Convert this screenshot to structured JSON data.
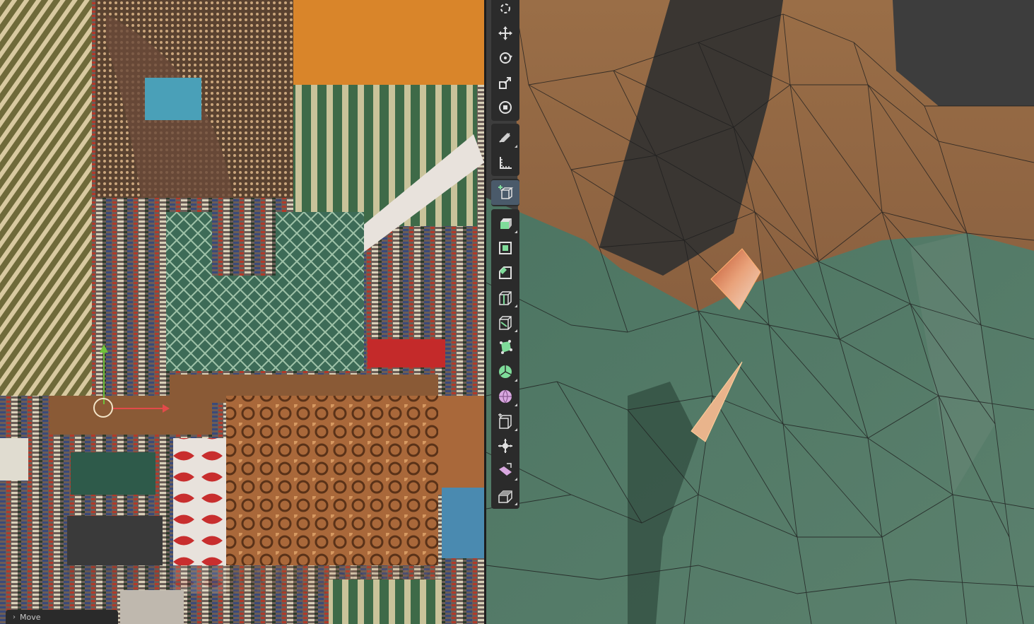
{
  "last_operator": {
    "label": "Move",
    "expand_icon": "chevron-right-icon"
  },
  "toolbar": {
    "groups": [
      [
        "cursor-tool",
        "move-tool",
        "rotate-tool",
        "scale-tool",
        "transform-tool"
      ],
      [
        "annotate-tool",
        "measure-tool"
      ],
      [
        "add-cube-tool"
      ],
      [
        "extrude-region-tool",
        "inset-faces-tool",
        "bevel-tool",
        "loop-cut-tool",
        "knife-tool",
        "poly-build-tool",
        "spin-tool",
        "smooth-vertices-tool",
        "edge-slide-tool",
        "shrink-fatten-tool",
        "shear-tool",
        "rip-region-tool"
      ]
    ]
  },
  "colors": {
    "toolbar_bg": "#2b2b2b",
    "gizmo_x": "#e24a4a",
    "gizmo_y": "#6fc13a",
    "mesh_skin": "#a7744a",
    "mesh_shirt": "#4f7560",
    "selected_face": "#e8a070"
  }
}
